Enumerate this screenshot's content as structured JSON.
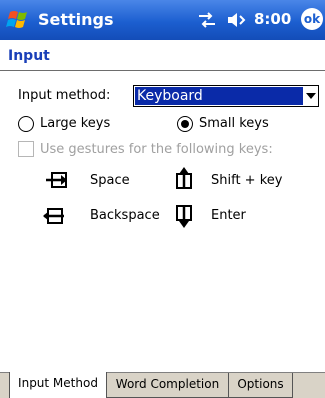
{
  "titlebar": {
    "title": "Settings",
    "time": "8:00",
    "ok_label": "ok",
    "icons": [
      "windows-start-icon",
      "connectivity-icon",
      "volume-icon"
    ]
  },
  "page": {
    "heading": "Input"
  },
  "input_method": {
    "label": "Input method:",
    "selected": "Keyboard"
  },
  "key_size": {
    "large_label": "Large keys",
    "small_label": "Small keys",
    "selected": "Small keys"
  },
  "gestures": {
    "checkbox_label": "Use gestures for the following keys:",
    "checked": false,
    "enabled": false,
    "items": [
      {
        "label": "Space",
        "icon": "space-gesture-icon"
      },
      {
        "label": "Shift + key",
        "icon": "shift-gesture-icon"
      },
      {
        "label": "Backspace",
        "icon": "backspace-gesture-icon"
      },
      {
        "label": "Enter",
        "icon": "enter-gesture-icon"
      }
    ]
  },
  "tabs": [
    {
      "label": "Input Method",
      "active": true
    },
    {
      "label": "Word Completion",
      "active": false
    },
    {
      "label": "Options",
      "active": false
    }
  ],
  "colors": {
    "titlebar": "#1c5fd0",
    "heading": "#1a3fb8",
    "selection": "#0a2aa8",
    "tabbar": "#d9d3c7"
  }
}
